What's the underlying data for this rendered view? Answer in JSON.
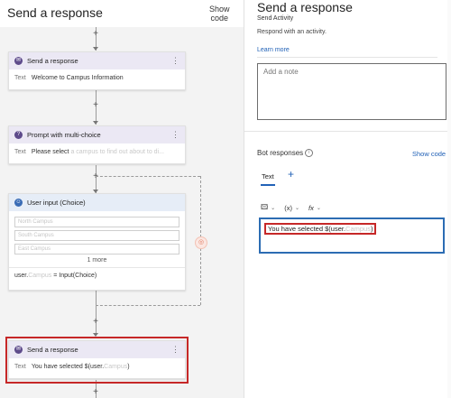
{
  "left": {
    "title": "Send a response",
    "show_code_line1": "Show",
    "show_code_line2": "code",
    "node1": {
      "title": "Send a response",
      "text_label": "Text",
      "text_value": "Welcome to Campus Information"
    },
    "node2": {
      "title": "Prompt with multi-choice",
      "text_label": "Text",
      "text_value": "Please select",
      "text_blurred": "a campus to find out about to di..."
    },
    "node3": {
      "title": "User input (Choice)",
      "choices": [
        "North Campus",
        "South Campus",
        "East Campus"
      ],
      "more": "1 more",
      "footer_prefix": "user.",
      "footer_blurred": "Campus",
      "footer_suffix": " = Input(Choice)"
    },
    "node4": {
      "title": "Send a response",
      "text_label": "Text",
      "text_value": "You have selected $(user.",
      "text_blurred": "Campus",
      "text_suffix": ")"
    }
  },
  "right": {
    "title": "Send a response",
    "subtitle": "Send Activity",
    "description": "Respond with an activity.",
    "learn_more": "Learn more",
    "note_placeholder": "Add a note",
    "bot_responses": "Bot responses",
    "show_code": "Show code",
    "tab_text": "Text",
    "toolbar": {
      "var": "(x)",
      "fx": "fx"
    },
    "editor": {
      "prefix": "You have selected $(user.",
      "blurred": "Campus",
      "suffix": ")"
    }
  },
  "colors": {
    "accent": "#2262b7",
    "highlight": "#c62828",
    "node_header": "#ebe8f4"
  }
}
